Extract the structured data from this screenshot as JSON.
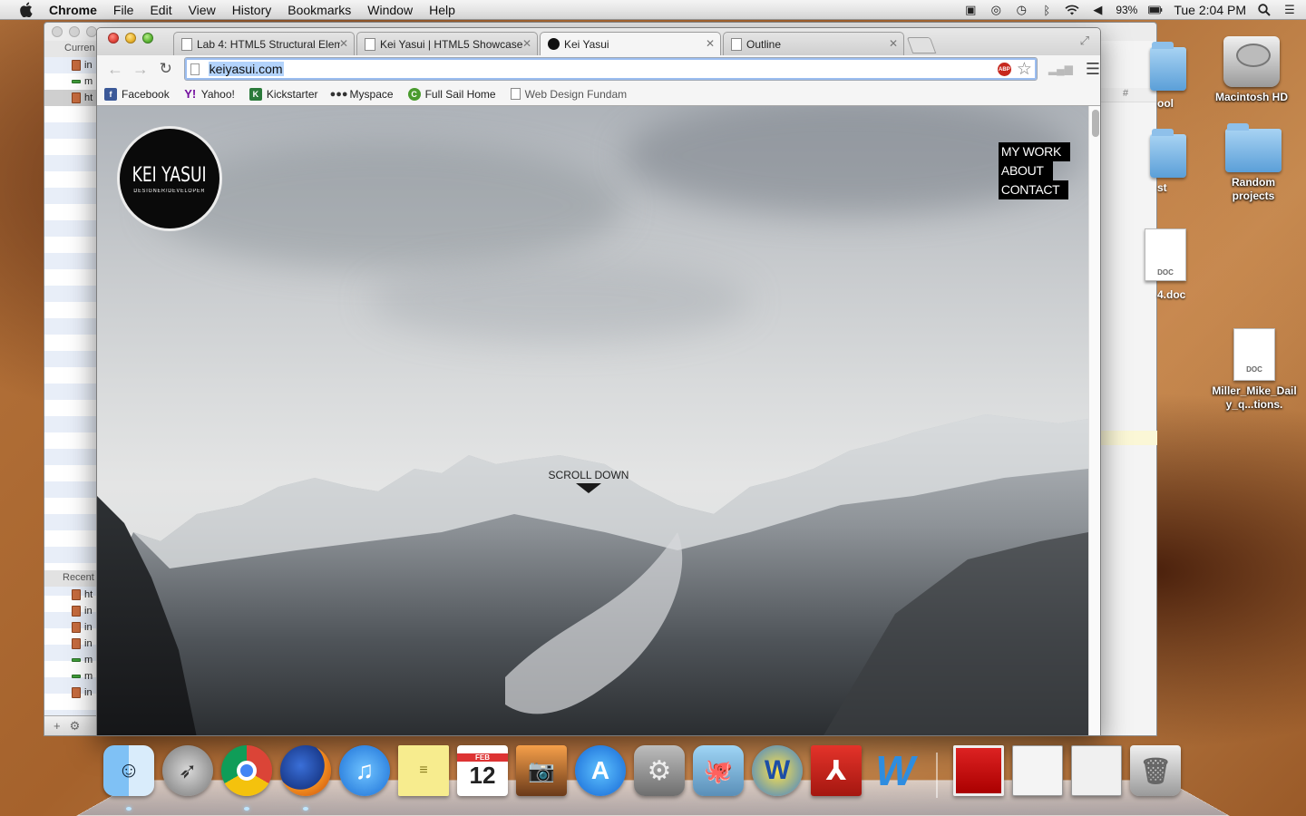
{
  "menubar": {
    "app_name": "Chrome",
    "items": [
      "File",
      "Edit",
      "View",
      "History",
      "Bookmarks",
      "Window",
      "Help"
    ],
    "battery": "93%",
    "clock": "Tue 2:04 PM"
  },
  "finder": {
    "sidebar_header": "Curren",
    "rows": [
      "in",
      "m",
      "ht"
    ],
    "recent_header": "Recent",
    "recent_rows": [
      "ht",
      "in",
      "in",
      "in",
      "m",
      "m",
      "in"
    ],
    "bottom_add": "+",
    "bottom_gear": "⚙"
  },
  "chrome": {
    "tabs": [
      {
        "title": "Lab 4: HTML5 Structural Elem",
        "active": false
      },
      {
        "title": "Kei Yasui | HTML5 Showcase",
        "active": false
      },
      {
        "title": "Kei Yasui",
        "active": true
      },
      {
        "title": "Outline",
        "active": false
      }
    ],
    "url": "keiyasui.com",
    "bookmarks": [
      "Facebook",
      "Yahoo!",
      "Kickstarter",
      "Myspace",
      "Full Sail Home",
      "Web Design Fundam"
    ]
  },
  "site": {
    "logo_name": "KEI YASUI",
    "logo_tagline": "DESIGNER/DEVELOPER",
    "nav": [
      "MY WORK",
      "ABOUT",
      "CONTACT"
    ],
    "scroll_label": "SCROLL DOWN"
  },
  "desktop": {
    "icons": [
      "Macintosh HD",
      "Random projects",
      "Miller_Mike_Daily_q...tions."
    ],
    "partial_labels": [
      "ool",
      "st",
      "4.doc"
    ],
    "doc_badge": "DOC"
  },
  "dock": {
    "items": [
      "finder-icon",
      "launchpad-icon",
      "chrome-icon",
      "firefox-icon",
      "itunes-icon",
      "stickies-icon",
      "calendar-icon",
      "iphoto-icon",
      "app-store-icon",
      "system-preferences-icon",
      "github-icon",
      "fetch-icon",
      "acrobat-icon",
      "word-icon"
    ],
    "calendar_month": "FEB",
    "calendar_day": "12"
  }
}
